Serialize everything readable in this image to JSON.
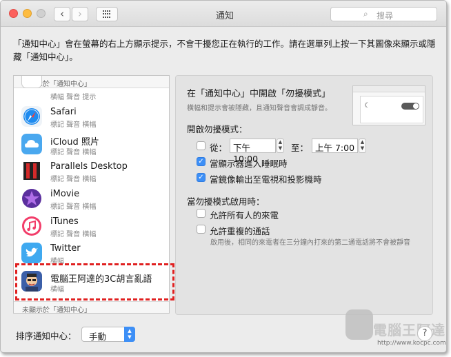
{
  "window": {
    "title": "通知",
    "search_placeholder": "搜尋",
    "back_icon": "chevron-left-icon",
    "forward_icon": "chevron-right-icon",
    "grid_icon": "show-all-grid-icon"
  },
  "intro_text": "「通知中心」會在螢幕的右上方顯示提示，不會干擾您正在執行的工作。請在選單列上按一下其圖像來顯示或隱藏「通知中心」。",
  "list": {
    "header": "已顯示於「通知中心」",
    "footer": "未顯示於「通知中心」",
    "items": [
      {
        "name": "",
        "sub": "橫幅 聲音 提示",
        "icon": "calendar-icon",
        "color": "#8a8a8a"
      },
      {
        "name": "Safari",
        "sub": "標記 聲音 橫幅",
        "icon": "safari-compass-icon",
        "color": "#1e8bef"
      },
      {
        "name": "iCloud 照片",
        "sub": "標記 聲音 橫幅",
        "icon": "icloud-icon",
        "color": "#4aa8ef"
      },
      {
        "name": "Parallels Desktop",
        "sub": "標記 聲音 橫幅",
        "icon": "parallels-icon",
        "color": "#c0202a"
      },
      {
        "name": "iMovie",
        "sub": "標記 聲音 橫幅",
        "icon": "imovie-star-icon",
        "color": "#6a3bbf"
      },
      {
        "name": "iTunes",
        "sub": "標記 聲音 橫幅",
        "icon": "itunes-note-icon",
        "color": "#f23d6a"
      },
      {
        "name": "Twitter",
        "sub": "橫幅",
        "icon": "twitter-bird-icon",
        "color": "#3fa9f0"
      },
      {
        "name": "電腦王阿達的3C胡言亂語",
        "sub": "橫幅",
        "icon": "avatar-icon",
        "color": "#4a6fb5"
      }
    ]
  },
  "dnd": {
    "title": "在「通知中心」中開啟「勿擾模式」",
    "subtitle": "橫幅和提示會被隱藏，且通知聲音會調成靜音。",
    "schedule_label": "開啟勿擾模式：",
    "from_label": "從：",
    "from_value": "下午10:00",
    "to_label": "至：",
    "to_value": "上午  7:00",
    "opt_display_sleep": "當顯示器進入睡眠時",
    "opt_mirroring": "當鏡像輸出至電視和投影機時",
    "when_on_label": "當勿擾模式啟用時：",
    "opt_allow_all": "允許所有人的來電",
    "opt_repeat": "允許重複的通話",
    "note": "啟用後，相同的來電者在三分鐘內打來的第二通電話將不會被靜音",
    "checks": {
      "from": false,
      "display_sleep": true,
      "mirroring": true,
      "allow_all": false,
      "repeat": false
    }
  },
  "sort": {
    "label": "排序通知中心：",
    "value": "手動"
  },
  "help_label": "?",
  "watermark": {
    "text": "電腦王阿達",
    "url": "http://www.kocpc.com.tw"
  }
}
